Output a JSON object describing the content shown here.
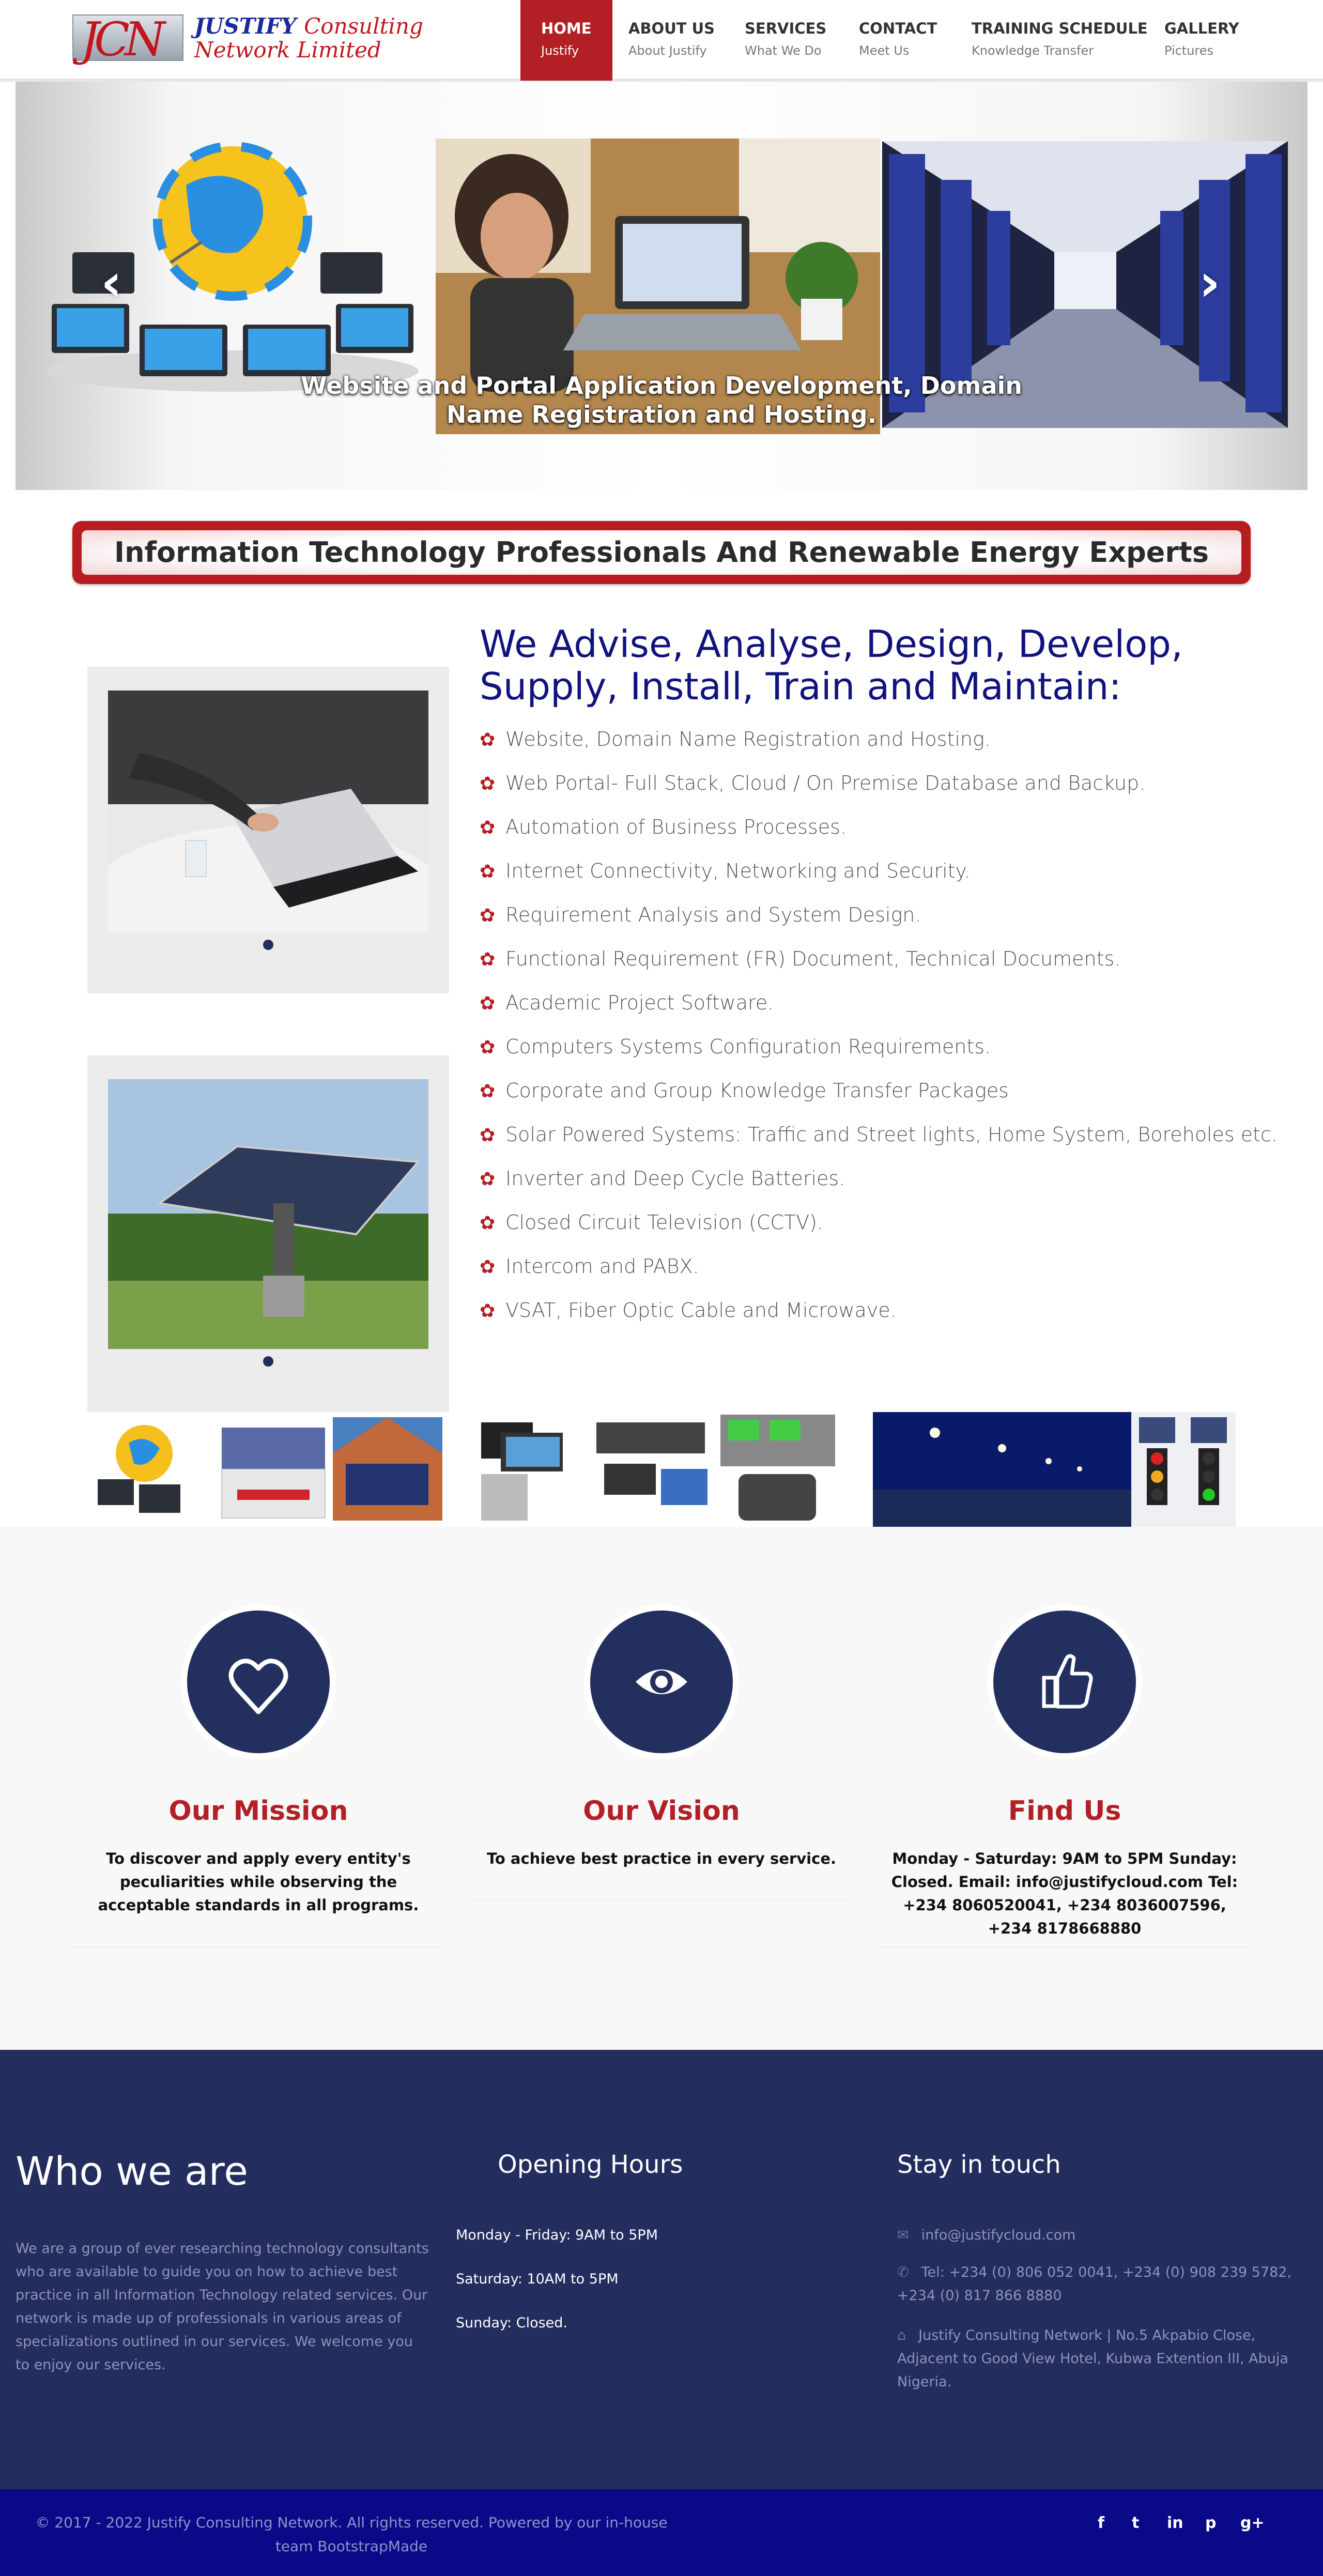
{
  "brand": {
    "mark": "JCN",
    "line1_a": "JUSTIFY",
    "line1_b": "Consulting",
    "line2": "Network Limited"
  },
  "nav": [
    {
      "label": "HOME",
      "sub": "Justify",
      "active": true
    },
    {
      "label": "ABOUT US",
      "sub": "About Justify"
    },
    {
      "label": "SERVICES",
      "sub": "What We Do"
    },
    {
      "label": "CONTACT",
      "sub": "Meet Us"
    },
    {
      "label": "TRAINING SCHEDULE",
      "sub": "Knowledge Transfer"
    },
    {
      "label": "GALLERY",
      "sub": "Pictures"
    }
  ],
  "hero": {
    "caption": "Website and Portal Application Development, Domain Name Registration and Hosting.",
    "prev": "‹",
    "next": "›"
  },
  "banner": "Information Technology Professionals And Renewable Energy Experts",
  "services": {
    "heading": "We Advise, Analyse, Design, Develop, Supply, Install, Train and Maintain:",
    "items": [
      "Website, Domain Name Registration and Hosting.",
      "Web Portal- Full Stack, Cloud / On Premise Database and Backup.",
      "Automation of Business Processes.",
      "Internet Connectivity, Networking and Security.",
      "Requirement Analysis and System Design.",
      "Functional Requirement (FR) Document, Technical Documents.",
      "Academic Project Software.",
      "Computers Systems Configuration Requirements.",
      "Corporate and Group Knowledge Transfer Packages",
      "Solar Powered Systems: Traffic and Street lights, Home System, Boreholes etc.",
      "Inverter and Deep Cycle Batteries.",
      "Closed Circuit Television (CCTV).",
      "Intercom and PABX.",
      "VSAT, Fiber Optic Cable and Microwave."
    ]
  },
  "features": [
    {
      "title": "Our Mission",
      "text": "To discover and apply every entity's peculiarities while observing the acceptable standards in all programs.",
      "icon": "heart-icon"
    },
    {
      "title": "Our Vision",
      "text": "To achieve best practice in every service.",
      "icon": "eye-icon"
    },
    {
      "title": "Find Us",
      "text": "Monday - Saturday: 9AM to 5PM Sunday: Closed. Email: info@justifycloud.com Tel: +234 8060520041, +234 8036007596, +234 8178668880",
      "icon": "thumbs-up-icon"
    }
  ],
  "footer": {
    "who_title": "Who we are",
    "who_text": "We are a group of ever researching technology consultants who are available to guide you on how to achieve best practice in all Information Technology related services. Our network is made up of professionals in various areas of specializations outlined in our services. We welcome you to enjoy our services.",
    "hours_title": "Opening Hours",
    "hours": [
      "Monday - Friday: 9AM to 5PM",
      "Saturday: 10AM to 5PM",
      "Sunday: Closed."
    ],
    "contact_title": "Stay in touch",
    "email": "info@justifycloud.com",
    "tel": "Tel: +234 (0) 806 052 0041, +234 (0) 908 239 5782, +234 (0) 817 866 8880",
    "address": "Justify Consulting Network | No.5 Akpabio Close, Adjacent to Good View Hotel, Kubwa Extention III, Abuja Nigeria."
  },
  "copyright": "© 2017 - 2022 Justify Consulting Network. All rights reserved. Powered by our in-house team BootstrapMade",
  "social": [
    "f",
    "t",
    "in",
    "p",
    "g+"
  ],
  "colors": {
    "accent": "#b21f24",
    "navy": "#232d5e",
    "heading_blue": "#10137e",
    "bottom_bar": "#0a0a88"
  }
}
